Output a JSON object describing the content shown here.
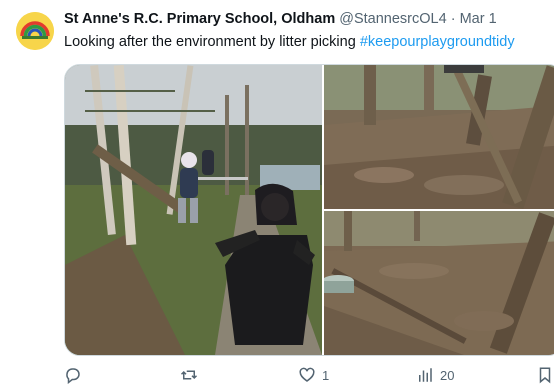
{
  "tweet": {
    "author_name": "St Anne's R.C. Primary School, Oldham",
    "handle": "@StannesrcOL4",
    "separator": "·",
    "date": "Mar 1",
    "text": "Looking after the environment by litter picking ",
    "hashtag": "#keepourplaygroundtidy"
  },
  "media": {
    "photos": [
      {
        "subject": "child-holding-bin-bag-in-woodland"
      },
      {
        "subject": "woodland-floor-with-trees"
      },
      {
        "subject": "woodland-path-with-planter"
      }
    ]
  },
  "actions": {
    "reply_count": "",
    "retweet_count": "",
    "like_count": "1",
    "views_count": "20"
  },
  "colors": {
    "accent": "#1d9bf0",
    "muted": "#536471",
    "text": "#0f1419"
  }
}
